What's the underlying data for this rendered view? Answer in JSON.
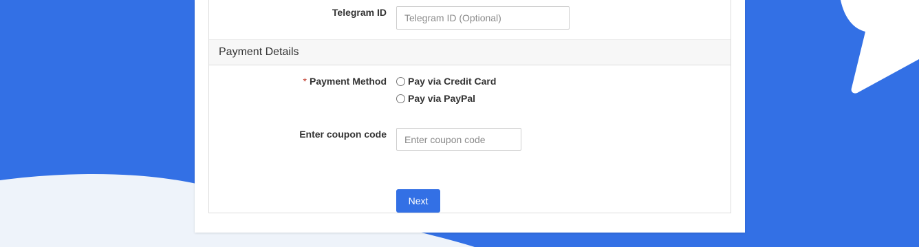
{
  "colors": {
    "background_blue": "#3370e5",
    "background_wave": "#eef3fa",
    "card": "#ffffff",
    "required_star": "#c0392b",
    "button": "#3370e5"
  },
  "telegram": {
    "label": "Telegram ID",
    "placeholder": "Telegram ID (Optional)",
    "value": ""
  },
  "payment_section": {
    "title": "Payment Details"
  },
  "payment_method": {
    "required_marker": "*",
    "label": "Payment Method",
    "options": [
      {
        "label": "Pay via Credit Card",
        "selected": false
      },
      {
        "label": "Pay via PayPal",
        "selected": false
      }
    ]
  },
  "coupon": {
    "label": "Enter coupon code",
    "placeholder": "Enter coupon code",
    "value": ""
  },
  "actions": {
    "next_label": "Next"
  }
}
